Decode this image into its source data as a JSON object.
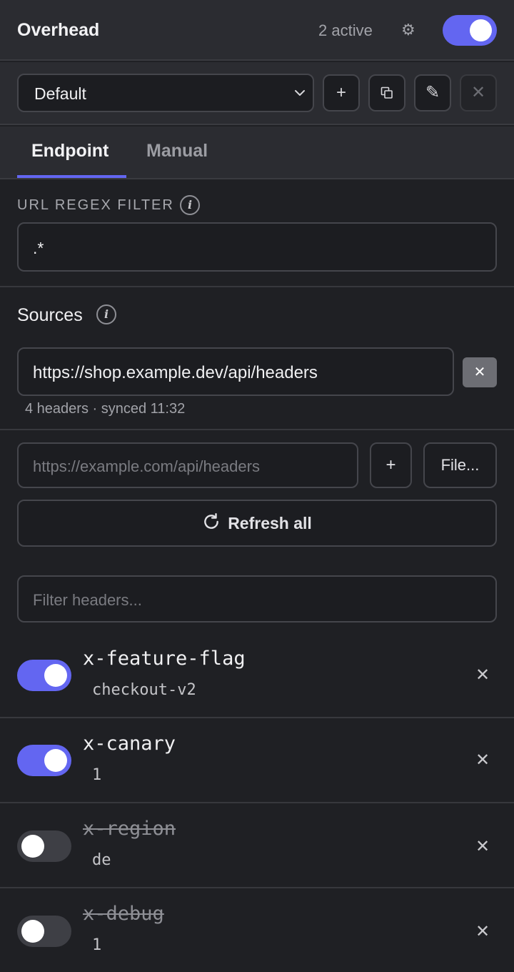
{
  "header": {
    "title": "Overhead",
    "active_count": "2 active",
    "settings_icon": "gear-icon",
    "master_enabled": true
  },
  "profile": {
    "selected": "Default",
    "add_icon": "plus-icon",
    "duplicate_icon": "duplicate-icon",
    "rename_icon": "pencil-icon",
    "delete_icon": "close-icon"
  },
  "tabs": [
    {
      "label": "Endpoint",
      "active": true
    },
    {
      "label": "Manual",
      "active": false
    }
  ],
  "url_filter": {
    "label": "URL REGEX FILTER",
    "value": ".*"
  },
  "sources": {
    "label": "Sources",
    "items": [
      {
        "url": "https://shop.example.dev/api/headers",
        "meta": "4 headers · synced 11:32"
      }
    ],
    "new_source_placeholder": "https://example.com/api/headers",
    "add_label": "+",
    "file_label": "File...",
    "refresh_label": "Refresh all"
  },
  "filter": {
    "placeholder": "Filter headers..."
  },
  "headers": [
    {
      "name": "x-feature-flag",
      "value": "checkout-v2",
      "enabled": true
    },
    {
      "name": "x-canary",
      "value": "1",
      "enabled": true
    },
    {
      "name": "x-region",
      "value": "de",
      "enabled": false
    },
    {
      "name": "x-debug",
      "value": "1",
      "enabled": false
    }
  ],
  "colors": {
    "accent": "#6366f1",
    "background": "#1f2024",
    "panel": "#2b2c31"
  }
}
